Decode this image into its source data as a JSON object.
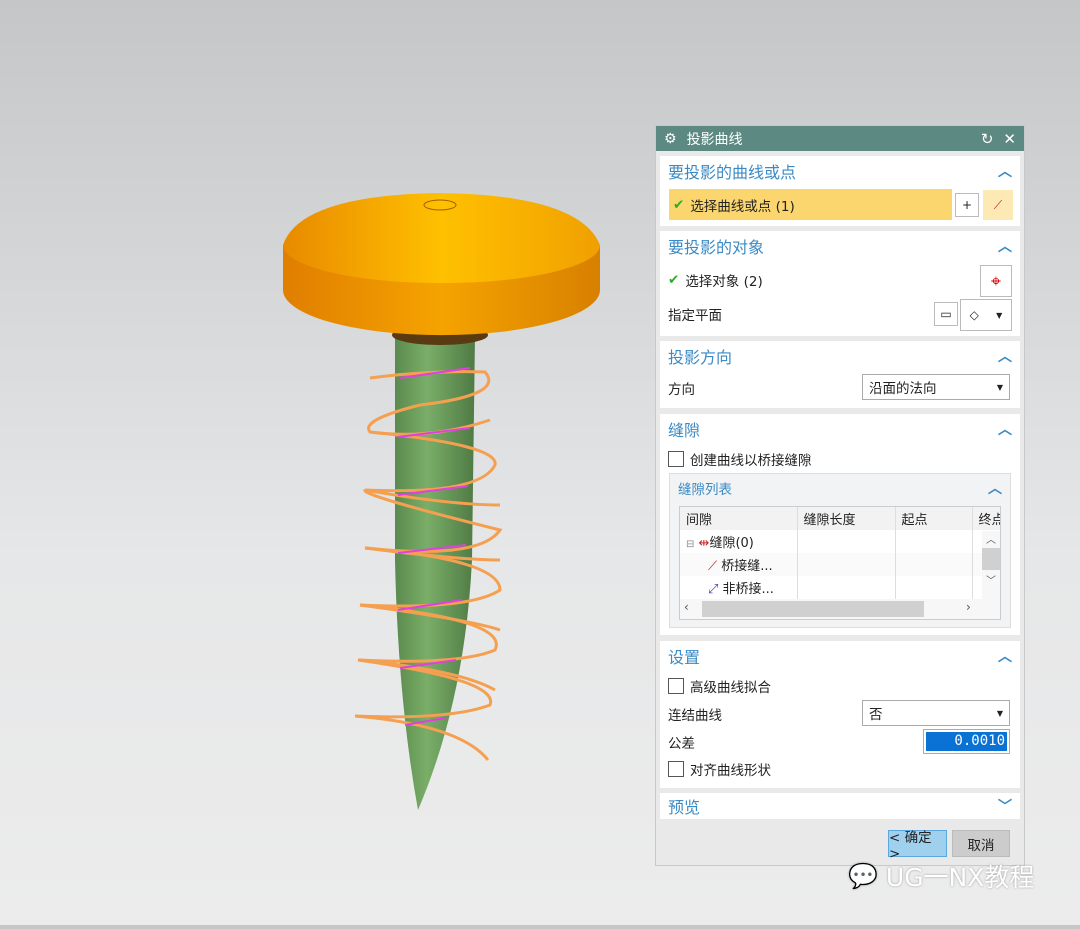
{
  "dialog": {
    "title": "投影曲线",
    "sections": {
      "curves": {
        "title": "要投影的曲线或点",
        "select_label": "选择曲线或点 (1)"
      },
      "objects": {
        "title": "要投影的对象",
        "select_label": "选择对象 (2)",
        "plane_label": "指定平面"
      },
      "direction": {
        "title": "投影方向",
        "label": "方向",
        "value": "沿面的法向"
      },
      "gap": {
        "title": "缝隙",
        "checkbox_label": "创建曲线以桥接缝隙",
        "list_title": "缝隙列表",
        "columns": [
          "间隙",
          "缝隙长度",
          "起点",
          "终点"
        ],
        "rows": [
          "缝隙(0)",
          "桥接缝...",
          "非桥接..."
        ]
      },
      "settings": {
        "title": "设置",
        "advanced_fit": "高级曲线拟合",
        "join_label": "连结曲线",
        "join_value": "否",
        "tolerance_label": "公差",
        "tolerance_value": "0.0010",
        "align_label": "对齐曲线形状"
      },
      "preview": {
        "title": "预览"
      }
    },
    "ok": "< 确定 >",
    "cancel": "取消"
  },
  "watermark": "UG一NX教程",
  "colors": {
    "titlebar": "#5c8a82",
    "accent": "#3b8ac4",
    "highlight": "#fbd56e",
    "head": "#f5a300",
    "shank": "#6a9a5a",
    "helix": "#f5a050"
  }
}
